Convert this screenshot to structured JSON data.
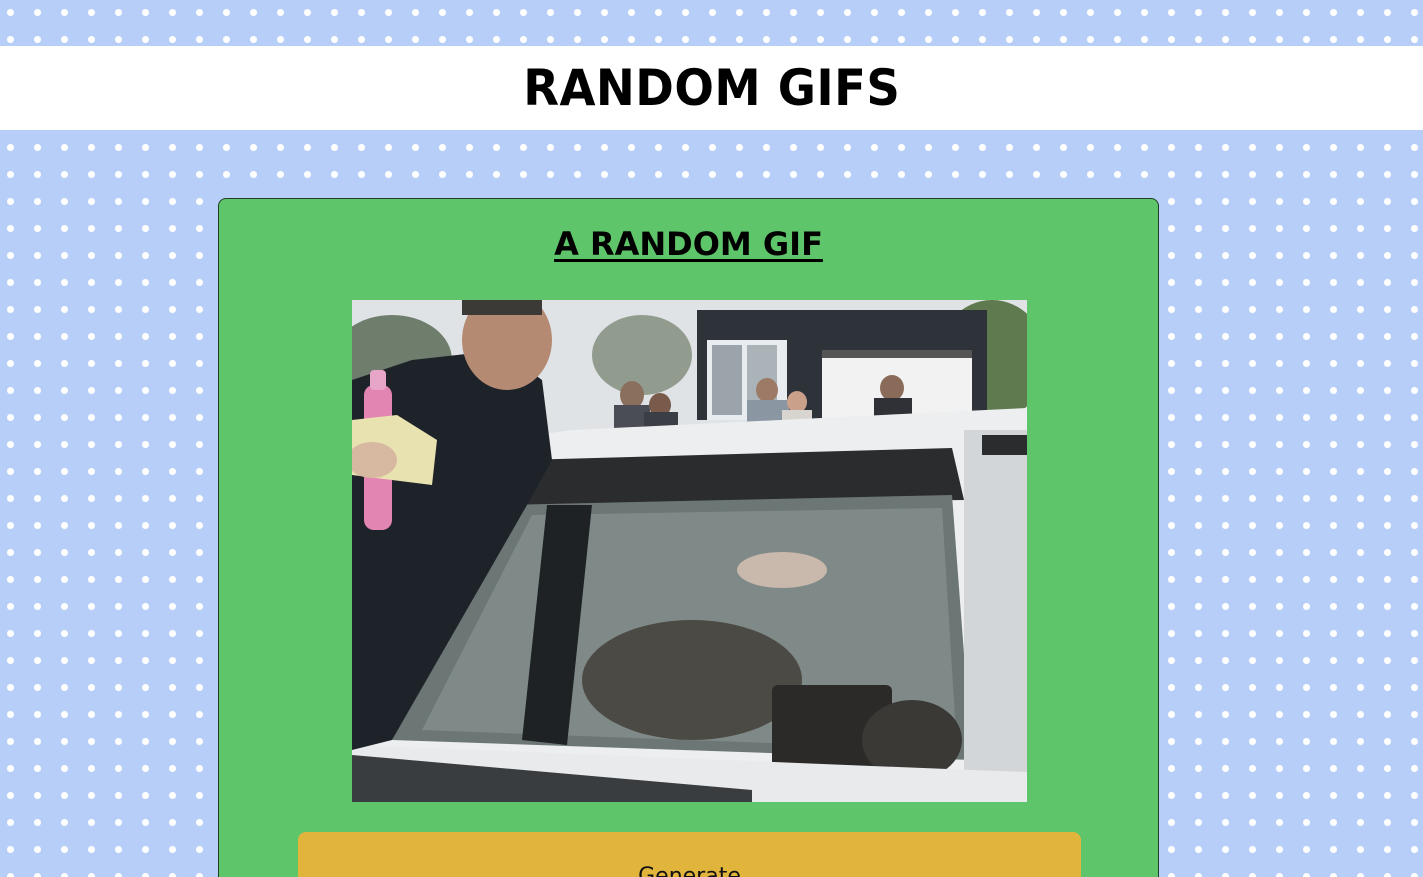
{
  "header": {
    "title": "RANDOM GIFS"
  },
  "card": {
    "title": "A RANDOM GIF",
    "gif_alt": "random gif",
    "generate_label": "Generate"
  },
  "colors": {
    "page_background": "#b6cef8",
    "polka_dot": "#ffffff",
    "header_background": "#ffffff",
    "card_background": "#5fc56a",
    "button_background": "#e1b43c"
  }
}
